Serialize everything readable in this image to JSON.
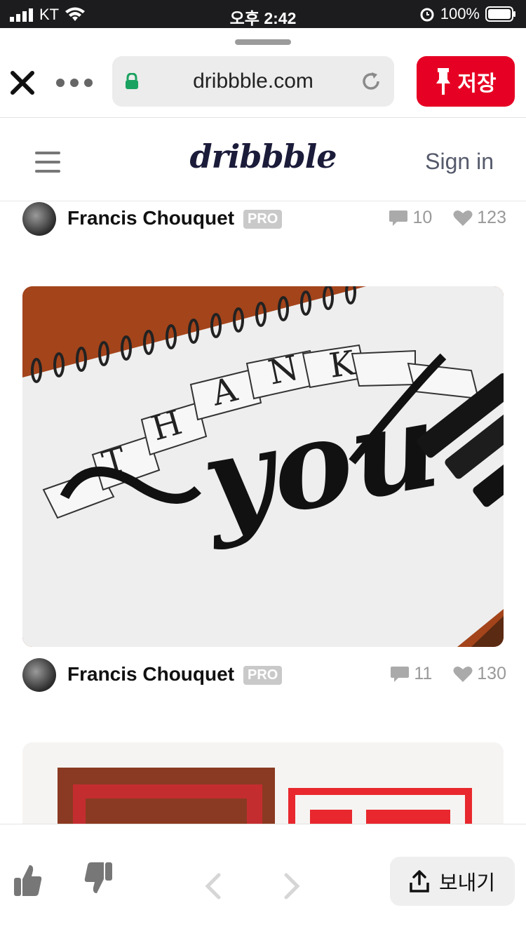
{
  "status_bar": {
    "carrier": "KT",
    "time": "오후 2:42",
    "battery": "100%"
  },
  "browser": {
    "url": "dribbble.com",
    "save_label": "저장",
    "send_label": "보내기"
  },
  "site": {
    "logo": "dribbble",
    "signin": "Sign in"
  },
  "shots": [
    {
      "author": "Francis Chouquet",
      "badge": "PRO",
      "comments": "10",
      "likes": "123"
    },
    {
      "author": "Francis Chouquet",
      "badge": "PRO",
      "comments": "11",
      "likes": "130"
    }
  ],
  "colors": {
    "accent": "#e60023",
    "logo": "#1b1b3a"
  },
  "icons": [
    "signal-icon",
    "wifi-icon",
    "alarm-icon",
    "battery-icon",
    "close-icon",
    "more-icon",
    "lock-icon",
    "reload-icon",
    "pin-icon",
    "menu-icon",
    "comment-icon",
    "heart-icon",
    "thumbs-up-icon",
    "thumbs-down-icon",
    "back-icon",
    "forward-icon",
    "share-icon"
  ]
}
